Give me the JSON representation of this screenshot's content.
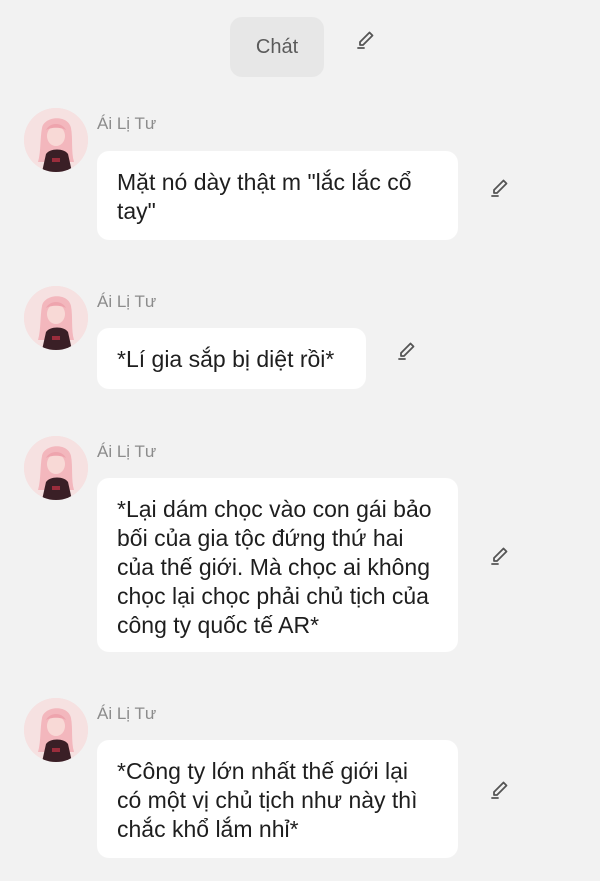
{
  "header": {
    "chip_label": "Chát"
  },
  "messages": [
    {
      "sender": "Ái Lị Tư",
      "text": "Mặt nó dày thật m \"lắc lắc cổ tay\""
    },
    {
      "sender": "Ái Lị Tư",
      "text": "*Lí gia sắp bị diệt rồi*"
    },
    {
      "sender": "Ái Lị Tư",
      "text": "*Lại dám chọc vào con gái bảo bối của gia tộc đứng thứ hai của thế giới. Mà chọc ai không chọc lại chọc phải chủ tịch của công ty quốc tế AR*"
    },
    {
      "sender": "Ái Lị Tư",
      "text": "*Công ty lớn nhất thế giới lại có một vị chủ tịch như này thì chắc khổ lắm nhỉ*"
    }
  ],
  "icons": {
    "edit": "pencil-edit-icon",
    "avatar": "anime-girl-avatar"
  },
  "colors": {
    "background": "#f2f2f2",
    "bubble": "#ffffff",
    "chip": "#e7e7e7",
    "name": "#8c8c8c",
    "text": "#1e1e1e"
  }
}
